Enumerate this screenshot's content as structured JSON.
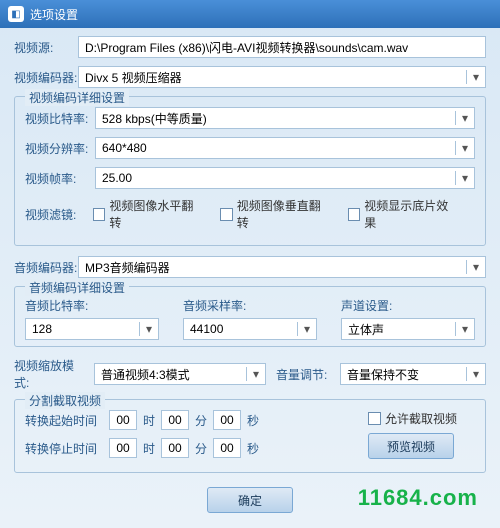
{
  "title": "选项设置",
  "watermark": "11684.com",
  "source": {
    "label": "视频源:",
    "value": "D:\\Program Files (x86)\\闪电-AVI视频转换器\\sounds\\cam.wav"
  },
  "videoEncoder": {
    "label": "视频编码器:",
    "value": "Divx 5 视频压缩器"
  },
  "videoGroup": {
    "title": "视频编码详细设置",
    "bitrate": {
      "label": "视频比特率:",
      "value": "528 kbps(中等质量)"
    },
    "resolution": {
      "label": "视频分辨率:",
      "value": "640*480"
    },
    "fps": {
      "label": "视频帧率:",
      "value": "25.00"
    },
    "filter": {
      "label": "视频滤镜:",
      "hflip": "视频图像水平翻转",
      "vflip": "视频图像垂直翻转",
      "negative": "视频显示底片效果"
    }
  },
  "audioEncoder": {
    "label": "音频编码器:",
    "value": "MP3音频编码器"
  },
  "audioGroup": {
    "title": "音频编码详细设置",
    "bitrate": {
      "label": "音频比特率:",
      "value": "128"
    },
    "samplerate": {
      "label": "音频采样率:",
      "value": "44100"
    },
    "channel": {
      "label": "声道设置:",
      "value": "立体声"
    }
  },
  "scale": {
    "label": "视频缩放模式:",
    "value": "普通视频4:3模式"
  },
  "volume": {
    "label": "音量调节:",
    "value": "音量保持不变"
  },
  "cutGroup": {
    "title": "分割截取视频",
    "start": {
      "label": "转换起始时间",
      "h": "00",
      "m": "00",
      "s": "00"
    },
    "end": {
      "label": "转换停止时间",
      "h": "00",
      "m": "00",
      "s": "00"
    },
    "units": {
      "h": "时",
      "m": "分",
      "s": "秒"
    },
    "allow": "允许截取视频",
    "preview": "预览视频"
  },
  "ok": "确定"
}
